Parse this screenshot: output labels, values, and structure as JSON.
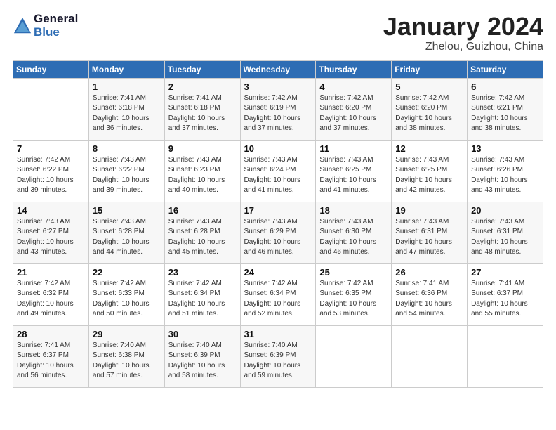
{
  "header": {
    "logo_line1": "General",
    "logo_line2": "Blue",
    "month": "January 2024",
    "location": "Zhelou, Guizhou, China"
  },
  "days_of_week": [
    "Sunday",
    "Monday",
    "Tuesday",
    "Wednesday",
    "Thursday",
    "Friday",
    "Saturday"
  ],
  "weeks": [
    [
      {
        "num": "",
        "info": ""
      },
      {
        "num": "1",
        "info": "Sunrise: 7:41 AM\nSunset: 6:18 PM\nDaylight: 10 hours\nand 36 minutes."
      },
      {
        "num": "2",
        "info": "Sunrise: 7:41 AM\nSunset: 6:18 PM\nDaylight: 10 hours\nand 37 minutes."
      },
      {
        "num": "3",
        "info": "Sunrise: 7:42 AM\nSunset: 6:19 PM\nDaylight: 10 hours\nand 37 minutes."
      },
      {
        "num": "4",
        "info": "Sunrise: 7:42 AM\nSunset: 6:20 PM\nDaylight: 10 hours\nand 37 minutes."
      },
      {
        "num": "5",
        "info": "Sunrise: 7:42 AM\nSunset: 6:20 PM\nDaylight: 10 hours\nand 38 minutes."
      },
      {
        "num": "6",
        "info": "Sunrise: 7:42 AM\nSunset: 6:21 PM\nDaylight: 10 hours\nand 38 minutes."
      }
    ],
    [
      {
        "num": "7",
        "info": "Sunrise: 7:42 AM\nSunset: 6:22 PM\nDaylight: 10 hours\nand 39 minutes."
      },
      {
        "num": "8",
        "info": "Sunrise: 7:43 AM\nSunset: 6:22 PM\nDaylight: 10 hours\nand 39 minutes."
      },
      {
        "num": "9",
        "info": "Sunrise: 7:43 AM\nSunset: 6:23 PM\nDaylight: 10 hours\nand 40 minutes."
      },
      {
        "num": "10",
        "info": "Sunrise: 7:43 AM\nSunset: 6:24 PM\nDaylight: 10 hours\nand 41 minutes."
      },
      {
        "num": "11",
        "info": "Sunrise: 7:43 AM\nSunset: 6:25 PM\nDaylight: 10 hours\nand 41 minutes."
      },
      {
        "num": "12",
        "info": "Sunrise: 7:43 AM\nSunset: 6:25 PM\nDaylight: 10 hours\nand 42 minutes."
      },
      {
        "num": "13",
        "info": "Sunrise: 7:43 AM\nSunset: 6:26 PM\nDaylight: 10 hours\nand 43 minutes."
      }
    ],
    [
      {
        "num": "14",
        "info": "Sunrise: 7:43 AM\nSunset: 6:27 PM\nDaylight: 10 hours\nand 43 minutes."
      },
      {
        "num": "15",
        "info": "Sunrise: 7:43 AM\nSunset: 6:28 PM\nDaylight: 10 hours\nand 44 minutes."
      },
      {
        "num": "16",
        "info": "Sunrise: 7:43 AM\nSunset: 6:28 PM\nDaylight: 10 hours\nand 45 minutes."
      },
      {
        "num": "17",
        "info": "Sunrise: 7:43 AM\nSunset: 6:29 PM\nDaylight: 10 hours\nand 46 minutes."
      },
      {
        "num": "18",
        "info": "Sunrise: 7:43 AM\nSunset: 6:30 PM\nDaylight: 10 hours\nand 46 minutes."
      },
      {
        "num": "19",
        "info": "Sunrise: 7:43 AM\nSunset: 6:31 PM\nDaylight: 10 hours\nand 47 minutes."
      },
      {
        "num": "20",
        "info": "Sunrise: 7:43 AM\nSunset: 6:31 PM\nDaylight: 10 hours\nand 48 minutes."
      }
    ],
    [
      {
        "num": "21",
        "info": "Sunrise: 7:42 AM\nSunset: 6:32 PM\nDaylight: 10 hours\nand 49 minutes."
      },
      {
        "num": "22",
        "info": "Sunrise: 7:42 AM\nSunset: 6:33 PM\nDaylight: 10 hours\nand 50 minutes."
      },
      {
        "num": "23",
        "info": "Sunrise: 7:42 AM\nSunset: 6:34 PM\nDaylight: 10 hours\nand 51 minutes."
      },
      {
        "num": "24",
        "info": "Sunrise: 7:42 AM\nSunset: 6:34 PM\nDaylight: 10 hours\nand 52 minutes."
      },
      {
        "num": "25",
        "info": "Sunrise: 7:42 AM\nSunset: 6:35 PM\nDaylight: 10 hours\nand 53 minutes."
      },
      {
        "num": "26",
        "info": "Sunrise: 7:41 AM\nSunset: 6:36 PM\nDaylight: 10 hours\nand 54 minutes."
      },
      {
        "num": "27",
        "info": "Sunrise: 7:41 AM\nSunset: 6:37 PM\nDaylight: 10 hours\nand 55 minutes."
      }
    ],
    [
      {
        "num": "28",
        "info": "Sunrise: 7:41 AM\nSunset: 6:37 PM\nDaylight: 10 hours\nand 56 minutes."
      },
      {
        "num": "29",
        "info": "Sunrise: 7:40 AM\nSunset: 6:38 PM\nDaylight: 10 hours\nand 57 minutes."
      },
      {
        "num": "30",
        "info": "Sunrise: 7:40 AM\nSunset: 6:39 PM\nDaylight: 10 hours\nand 58 minutes."
      },
      {
        "num": "31",
        "info": "Sunrise: 7:40 AM\nSunset: 6:39 PM\nDaylight: 10 hours\nand 59 minutes."
      },
      {
        "num": "",
        "info": ""
      },
      {
        "num": "",
        "info": ""
      },
      {
        "num": "",
        "info": ""
      }
    ]
  ]
}
